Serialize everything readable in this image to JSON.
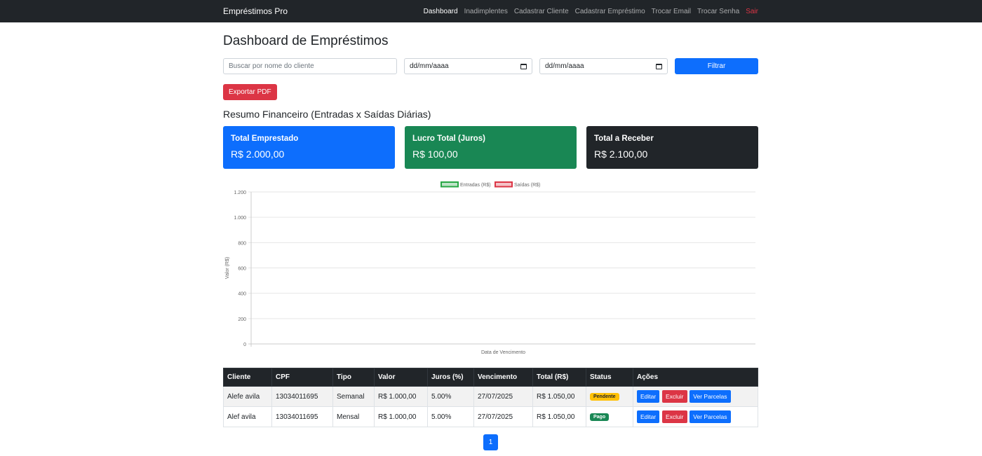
{
  "nav": {
    "brand": "Empréstimos Pro",
    "links": [
      {
        "label": "Dashboard"
      },
      {
        "label": "Inadimplentes"
      },
      {
        "label": "Cadastrar Cliente"
      },
      {
        "label": "Cadastrar Empréstimo"
      },
      {
        "label": "Trocar Email"
      },
      {
        "label": "Trocar Senha"
      },
      {
        "label": "Sair"
      }
    ]
  },
  "page": {
    "title": "Dashboard de Empréstimos"
  },
  "filters": {
    "search_placeholder": "Buscar por nome do cliente",
    "date_from": "dd/mm/aaaa",
    "date_to": "dd/mm/aaaa",
    "filter_label": "Filtrar"
  },
  "export_label": "Exportar PDF",
  "summary": {
    "title": "Resumo Financeiro (Entradas x Saídas Diárias)",
    "cards": [
      {
        "label": "Total Emprestado",
        "value": "R$ 2.000,00"
      },
      {
        "label": "Lucro Total (Juros)",
        "value": "R$ 100,00"
      },
      {
        "label": "Total a Receber",
        "value": "R$ 2.100,00"
      }
    ]
  },
  "colors": {
    "primary": "#0d6efd",
    "success": "#198754",
    "danger": "#dc3545",
    "dark": "#212529",
    "warning": "#ffc107"
  },
  "chart_data": {
    "type": "line",
    "x": [],
    "series": [
      {
        "name": "Entradas (R$)",
        "values": [],
        "color": "#28a745"
      },
      {
        "name": "Saídas (R$)",
        "values": [],
        "color": "#dc3545"
      }
    ],
    "xlabel": "Data de Vencimento",
    "ylabel": "Valor (R$)",
    "ylim": [
      0,
      1200
    ],
    "yticks": [
      "0",
      "200",
      "400",
      "600",
      "800",
      "1.000",
      "1.200"
    ],
    "grid": true,
    "legend": "top-center"
  },
  "table": {
    "columns": [
      "Cliente",
      "CPF",
      "Tipo",
      "Valor",
      "Juros (%)",
      "Vencimento",
      "Total (R$)",
      "Status",
      "Ações"
    ],
    "rows": [
      {
        "cliente": "Alefe avila",
        "cpf": "13034011695",
        "tipo": "Semanal",
        "valor": "R$ 1.000,00",
        "juros": "5.00%",
        "vencimento": "27/07/2025",
        "total": "R$ 1.050,00",
        "status": "Pendente"
      },
      {
        "cliente": "Alef avila",
        "cpf": "13034011695",
        "tipo": "Mensal",
        "valor": "R$ 1.000,00",
        "juros": "5.00%",
        "vencimento": "27/07/2025",
        "total": "R$ 1.050,00",
        "status": "Pago"
      }
    ],
    "actions": {
      "edit": "Editar",
      "delete": "Excluir",
      "view": "Ver Parcelas"
    }
  },
  "pagination": {
    "current": "1"
  }
}
